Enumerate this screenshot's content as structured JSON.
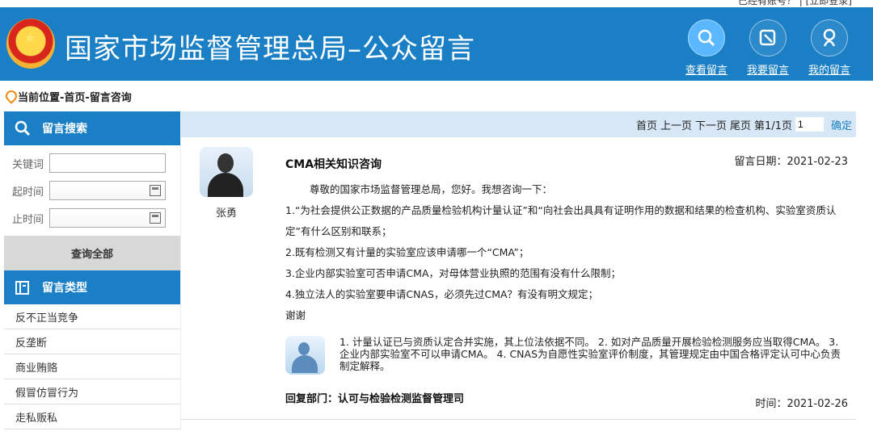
{
  "header": {
    "top_links": "已经有账号？  |  [立即登录]",
    "site_title": "国家市场监督管理总局–公众留言",
    "nav": [
      {
        "label": "查看留言",
        "icon": "search-icon"
      },
      {
        "label": "我要留言",
        "icon": "compose-icon"
      },
      {
        "label": "我的留言",
        "icon": "user-icon"
      }
    ]
  },
  "breadcrumb": "当前位置-首页-留言咨询",
  "sidebar": {
    "search_title": "留言搜索",
    "keyword_label": "关键词",
    "start_label": "起时间",
    "end_label": "止时间",
    "query_all": "查询全部",
    "category_title": "留言类型",
    "categories": [
      "反不正当竞争",
      "反垄断",
      "商业贿赂",
      "假冒仿冒行为",
      "走私贩私"
    ]
  },
  "pager": {
    "first": "首页",
    "prev": "上一页",
    "next": "下一页",
    "last": "尾页",
    "page_info": "第1/1页",
    "page_value": "1",
    "confirm": "确定"
  },
  "message": {
    "user": "张勇",
    "title": "CMA相关知识咨询",
    "date": "留言日期：2021-02-23",
    "paragraphs": [
      "尊敬的国家市场监督管理总局，您好。我想咨询一下：",
      "1.“为社会提供公正数据的产品质量检验机构计量认证”和“向社会出具具有证明作用的数据和结果的检查机构、实验室资质认定”有什么区别和联系；",
      "2.既有检测又有计量的实验室应该申请哪一个“CMA”；",
      "3.企业内部实验室可否申请CMA，对母体营业执照的范围有没有什么限制；",
      "4.独立法人的实验室要申请CNAS，必须先过CMA？有没有明文规定；",
      "谢谢"
    ],
    "reply": "1. 计量认证已与资质认定合并实施，其上位法依据不同。 2. 如对产品质量开展检验检测服务应当取得CMA。 3. 企业内部实验室不可以申请CMA。 4. CNAS为自愿性实验室评价制度，其管理规定由中国合格评定认可中心负责制定解释。",
    "reply_dept": "回复部门：认可与检验检测监督管理司",
    "reply_time": "时间：2021-02-26"
  }
}
